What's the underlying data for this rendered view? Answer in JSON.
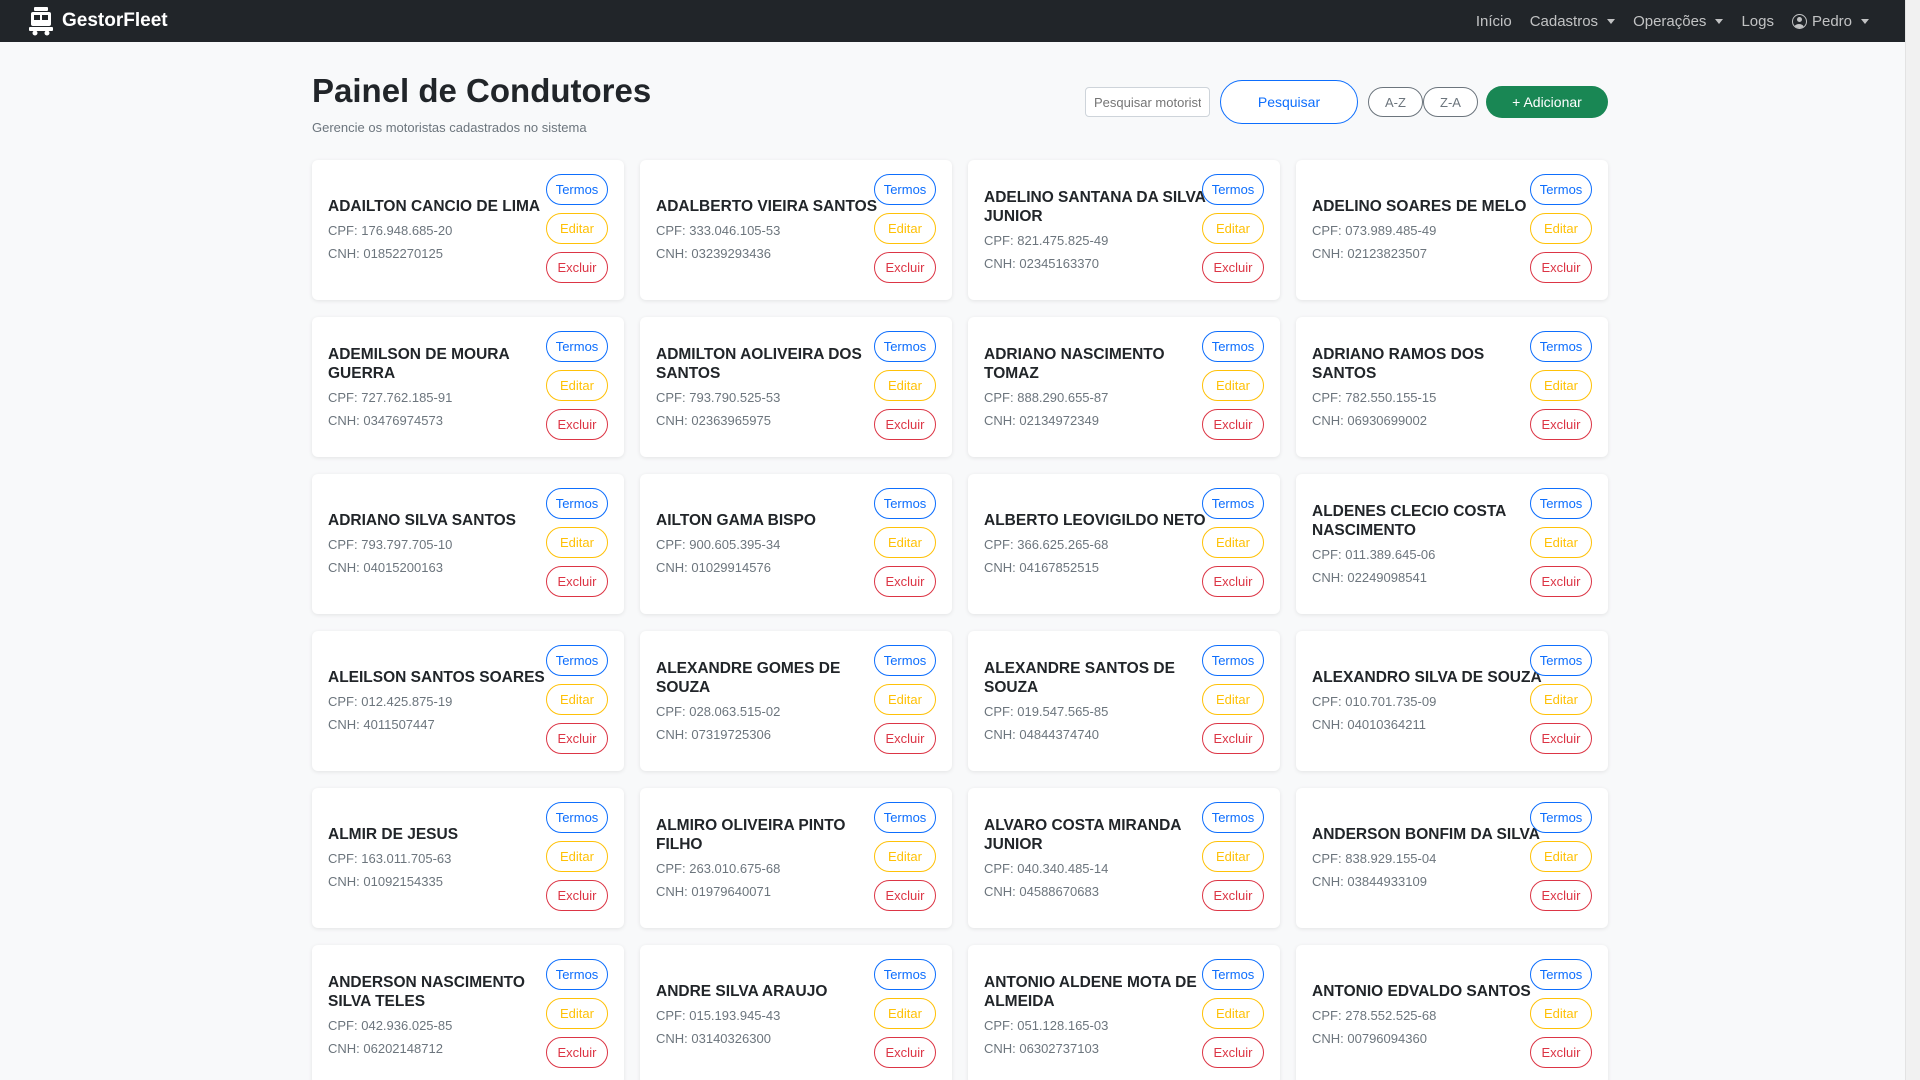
{
  "nav": {
    "brand": "GestorFleet",
    "links": [
      {
        "label": "Início",
        "dropdown": false
      },
      {
        "label": "Cadastros",
        "dropdown": true
      },
      {
        "label": "Operações",
        "dropdown": true
      },
      {
        "label": "Logs",
        "dropdown": false
      }
    ],
    "user": "Pedro"
  },
  "page": {
    "title": "Painel de Condutores",
    "subtitle": "Gerencie os motoristas cadastrados no sistema"
  },
  "toolbar": {
    "search_placeholder": "Pesquisar motorista",
    "search_label": "Pesquisar",
    "sort_az": "A-Z",
    "sort_za": "Z-A",
    "add_label": "+ Adicionar"
  },
  "card_labels": {
    "termos": "Termos",
    "editar": "Editar",
    "excluir": "Excluir",
    "cpf_prefix": "CPF: ",
    "cnh_prefix": "CNH: "
  },
  "drivers": [
    {
      "name": "ADAILTON CANCIO DE LIMA",
      "cpf": "176.948.685-20",
      "cnh": "01852270125"
    },
    {
      "name": "ADALBERTO VIEIRA SANTOS",
      "cpf": "333.046.105-53",
      "cnh": "03239293436"
    },
    {
      "name": "ADELINO SANTANA DA SILVA JUNIOR",
      "cpf": "821.475.825-49",
      "cnh": "02345163370"
    },
    {
      "name": "ADELINO SOARES DE MELO",
      "cpf": "073.989.485-49",
      "cnh": "02123823507"
    },
    {
      "name": "ADEMILSON DE MOURA GUERRA",
      "cpf": "727.762.185-91",
      "cnh": "03476974573"
    },
    {
      "name": "ADMILTON AOLIVEIRA DOS SANTOS",
      "cpf": "793.790.525-53",
      "cnh": "02363965975"
    },
    {
      "name": "ADRIANO NASCIMENTO TOMAZ",
      "cpf": "888.290.655-87",
      "cnh": "02134972349"
    },
    {
      "name": "ADRIANO RAMOS DOS SANTOS",
      "cpf": "782.550.155-15",
      "cnh": "06930699002"
    },
    {
      "name": "ADRIANO SILVA SANTOS",
      "cpf": "793.797.705-10",
      "cnh": "04015200163"
    },
    {
      "name": "AILTON GAMA BISPO",
      "cpf": "900.605.395-34",
      "cnh": "01029914576"
    },
    {
      "name": "ALBERTO LEOVIGILDO NETO",
      "cpf": "366.625.265-68",
      "cnh": "04167852515"
    },
    {
      "name": "ALDENES CLECIO COSTA NASCIMENTO",
      "cpf": "011.389.645-06",
      "cnh": "02249098541"
    },
    {
      "name": "ALEILSON SANTOS SOARES",
      "cpf": "012.425.875-19",
      "cnh": "4011507447"
    },
    {
      "name": "ALEXANDRE GOMES DE SOUZA",
      "cpf": "028.063.515-02",
      "cnh": "07319725306"
    },
    {
      "name": "ALEXANDRE SANTOS DE SOUZA",
      "cpf": "019.547.565-85",
      "cnh": "04844374740"
    },
    {
      "name": "ALEXANDRO SILVA DE SOUZA",
      "cpf": "010.701.735-09",
      "cnh": "04010364211"
    },
    {
      "name": "ALMIR DE JESUS",
      "cpf": "163.011.705-63",
      "cnh": "01092154335"
    },
    {
      "name": "ALMIRO OLIVEIRA PINTO FILHO",
      "cpf": "263.010.675-68",
      "cnh": "01979640071"
    },
    {
      "name": "ALVARO COSTA MIRANDA JUNIOR",
      "cpf": "040.340.485-14",
      "cnh": "04588670683"
    },
    {
      "name": "ANDERSON BONFIM DA SILVA",
      "cpf": "838.929.155-04",
      "cnh": "03844933109"
    },
    {
      "name": "ANDERSON NASCIMENTO SILVA TELES",
      "cpf": "042.936.025-85",
      "cnh": "06202148712"
    },
    {
      "name": "ANDRE SILVA ARAUJO",
      "cpf": "015.193.945-43",
      "cnh": "03140326300"
    },
    {
      "name": "ANTONIO ALDENE MOTA DE ALMEIDA",
      "cpf": "051.128.165-03",
      "cnh": "06302737103"
    },
    {
      "name": "ANTONIO EDVALDO SANTOS",
      "cpf": "278.552.525-68",
      "cnh": "00796094360"
    }
  ]
}
